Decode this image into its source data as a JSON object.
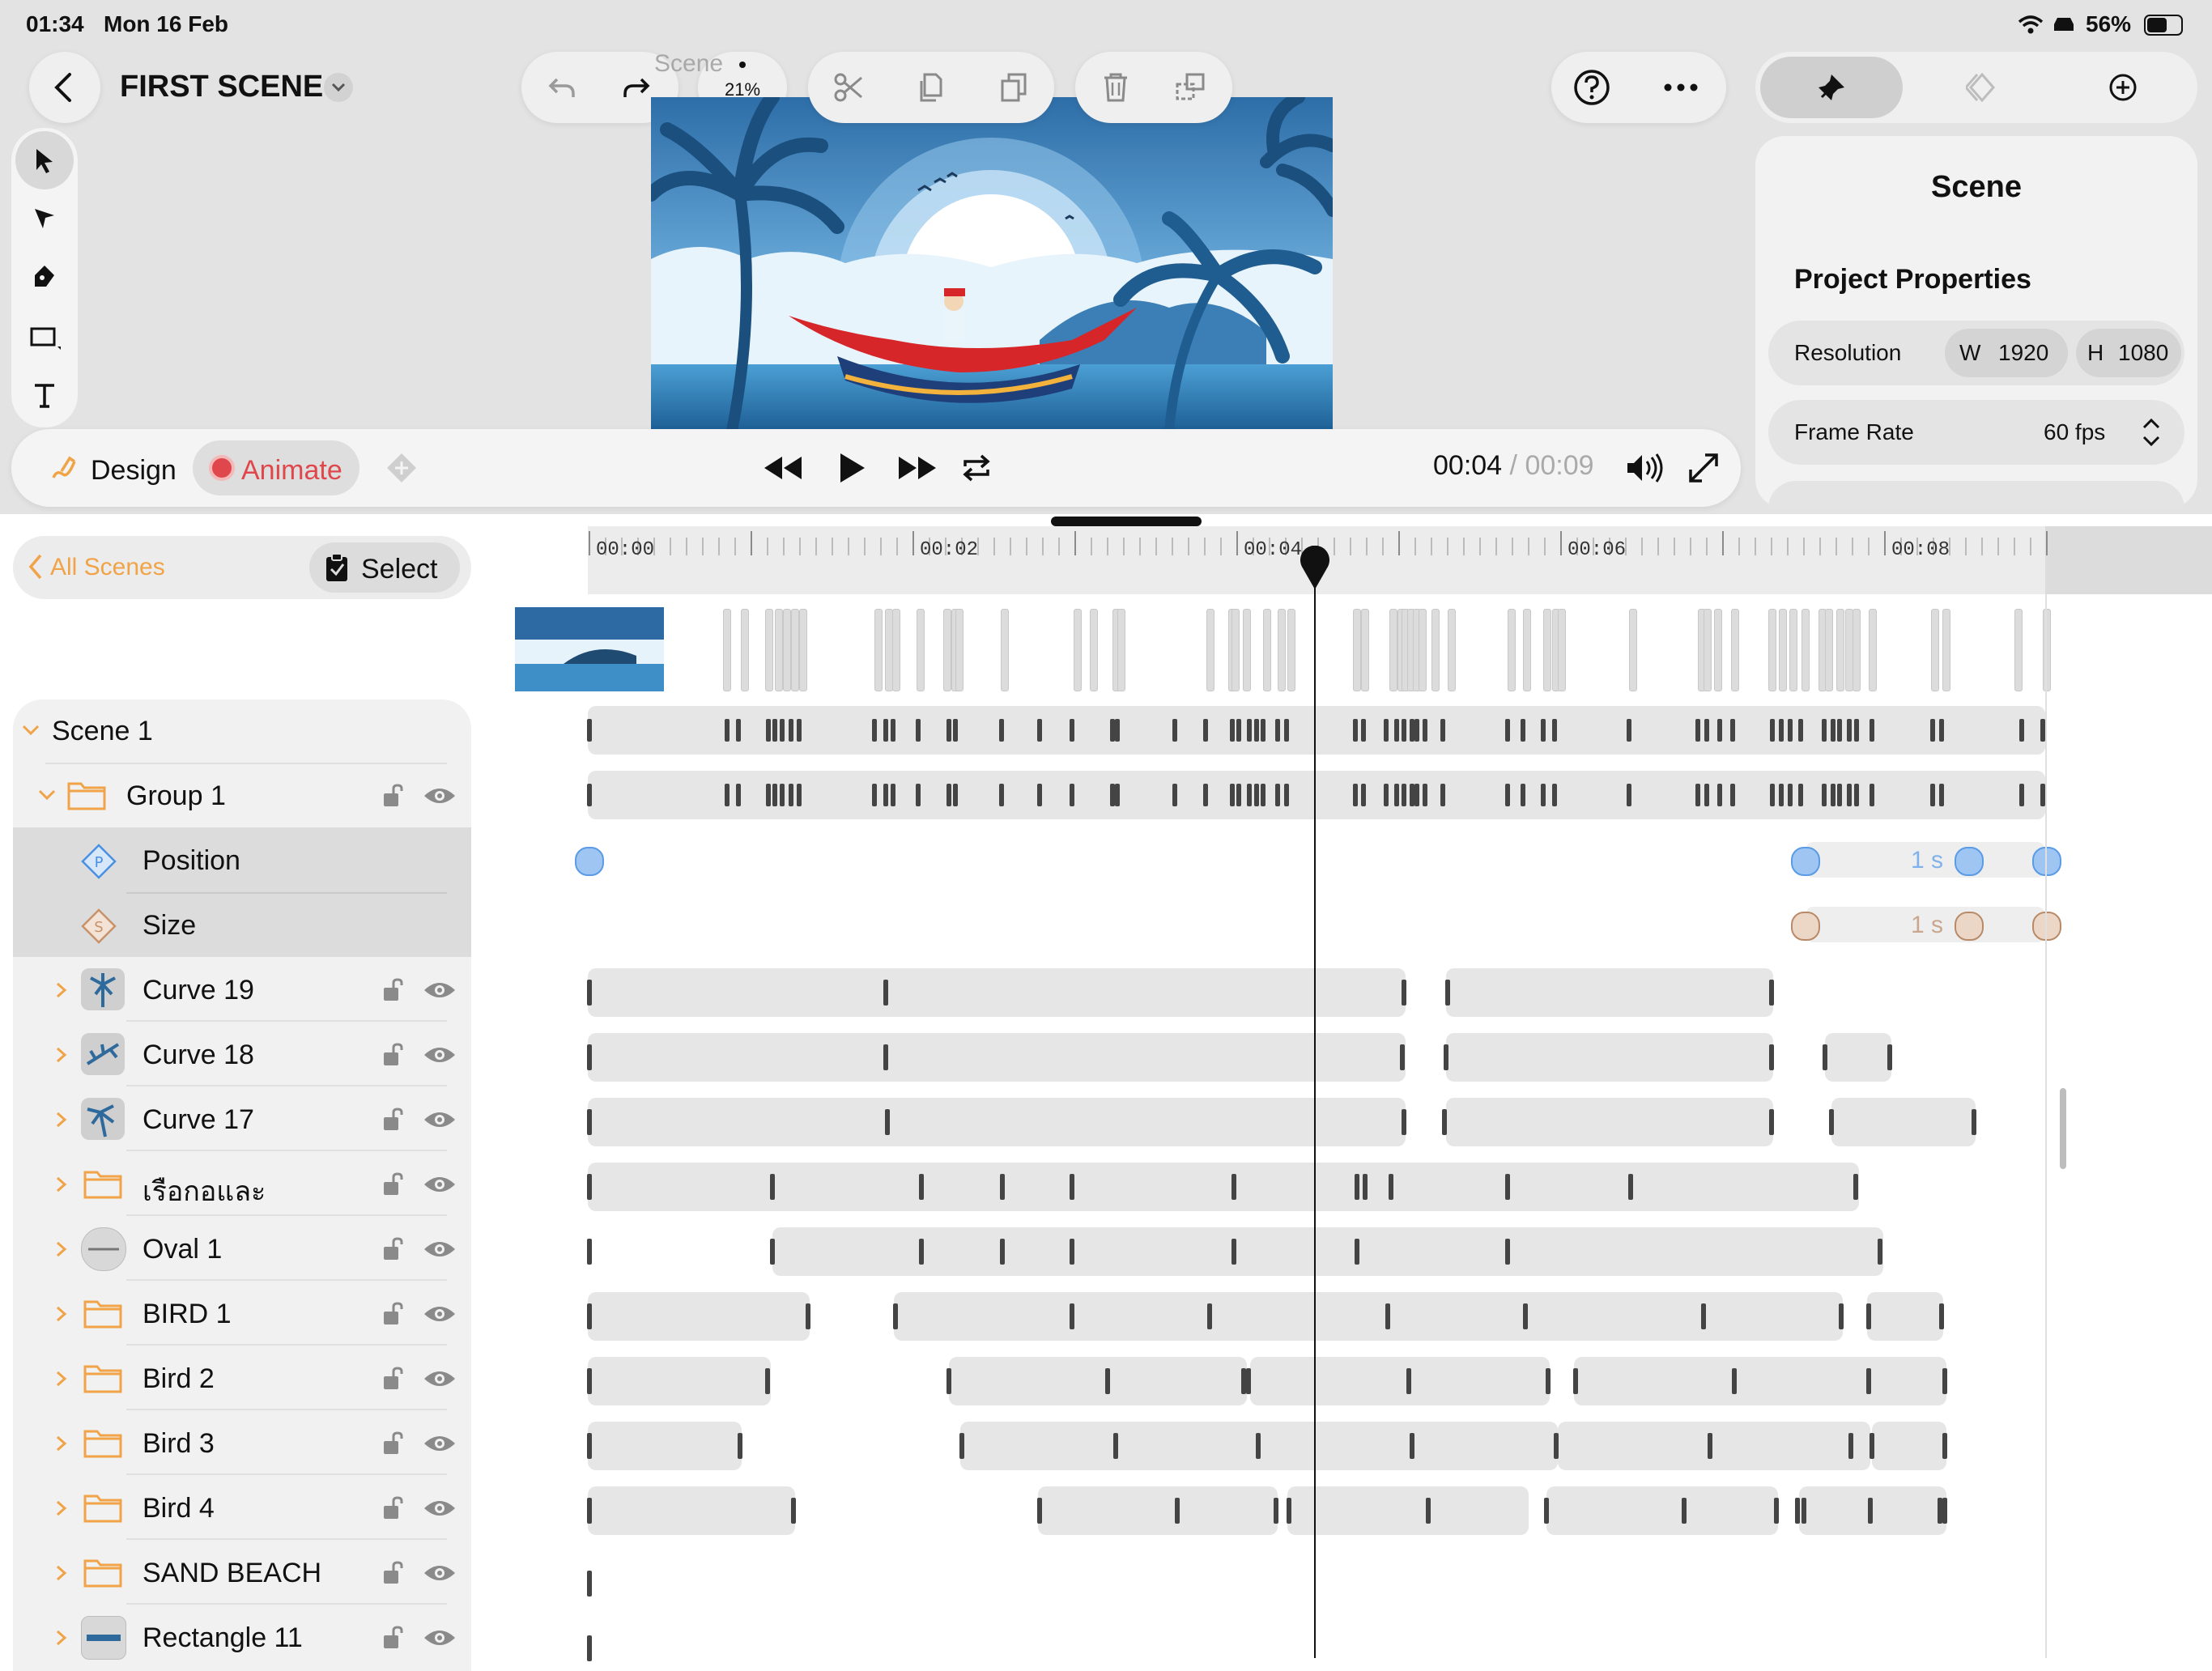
{
  "status": {
    "time": "01:34",
    "date": "Mon 16 Feb",
    "battery": "56%"
  },
  "header": {
    "scene_title": "FIRST SCENE",
    "zoom": "21%",
    "canvas_ghost": "Scene"
  },
  "inspector": {
    "title": "Scene",
    "section": "Project Properties",
    "resolution_label": "Resolution",
    "w_label": "W",
    "w_value": "1920",
    "h_label": "H",
    "h_value": "1080",
    "framerate_label": "Frame Rate",
    "framerate_value": "60 fps"
  },
  "modes": {
    "design": "Design",
    "animate": "Animate"
  },
  "playback": {
    "current": "00:04",
    "separator": "/",
    "total": "00:09"
  },
  "panel": {
    "all_scenes": "All Scenes",
    "select": "Select"
  },
  "ruler": [
    "00:00",
    "00:02",
    "00:04",
    "00:06",
    "00:08"
  ],
  "layers": {
    "scene": "Scene 1",
    "group": "Group 1",
    "position": "Position",
    "size": "Size",
    "items": [
      "Curve 19",
      "Curve 18",
      "Curve 17",
      "เรือกอและ",
      "Oval 1",
      "BIRD 1",
      "Bird 2",
      "Bird 3",
      "Bird 4",
      "SAND BEACH",
      "Rectangle 11"
    ]
  },
  "keyframes": {
    "position_duration": "1 s",
    "size_duration": "1 s"
  },
  "colors": {
    "accent_orange": "#f0a347",
    "record_red": "#e0474c",
    "position_blue": "#9fc5f2",
    "size_tan": "#e8c7b0"
  }
}
